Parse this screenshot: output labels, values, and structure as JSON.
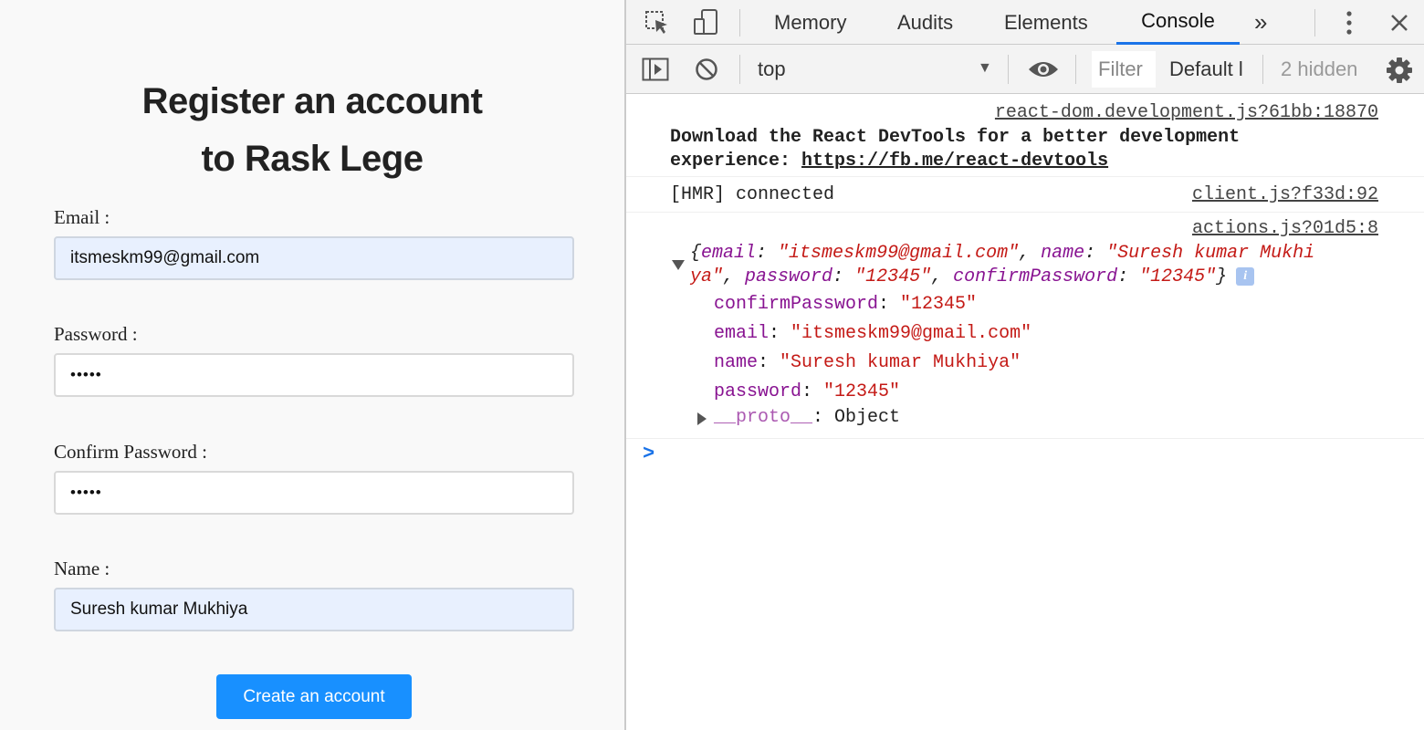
{
  "page": {
    "title_line1": "Register an account",
    "title_line2": "to Rask Lege",
    "fields": [
      {
        "label": "Email",
        "colon": ":",
        "value": "itsmeskm99@gmail.com"
      },
      {
        "label": "Password",
        "colon": ":",
        "value": "•••••"
      },
      {
        "label": "Confirm Password",
        "colon": ":",
        "value": "•••••"
      },
      {
        "label": "Name",
        "colon": ":",
        "value": "Suresh kumar Mukhiya"
      }
    ],
    "submit_label": "Create an account"
  },
  "devtools": {
    "tabs": [
      "Memory",
      "Audits",
      "Elements",
      "Console"
    ],
    "active_tab": "Console",
    "more_tabs": "»",
    "context": "top",
    "filter_placeholder": "Filter",
    "levels": "Default l",
    "hidden": "2 hidden",
    "icons": {
      "inspect": "inspect-element-icon",
      "device": "device-toolbar-icon",
      "menu": "kebab-menu-icon",
      "close": "close-icon",
      "sidebar": "console-sidebar-icon",
      "clear": "clear-console-icon",
      "eye": "live-expression-icon",
      "settings": "gear-icon"
    },
    "console": {
      "msg1": {
        "source": "react-dom.development.js?61bb:18870",
        "text1": "Download the React DevTools for a better development",
        "text2": "experience: ",
        "link": "https://fb.me/react-devtools"
      },
      "msg2": {
        "source": "client.js?f33d:92",
        "text": "[HMR] connected"
      },
      "msg3": {
        "source": "actions.js?01d5:8",
        "k_email": "email",
        "v_email": "\"itsmeskm99@gmail.com\"",
        "k_name": "name",
        "v_name_a": "\"Suresh kumar Mukhi",
        "v_name_b": "ya\"",
        "k_password": "password",
        "v_password": "\"12345\"",
        "k_confirm": "confirmPassword",
        "v_confirm": "\"12345\"",
        "expanded": [
          {
            "key": "confirmPassword",
            "value": "\"12345\""
          },
          {
            "key": "email",
            "value": "\"itsmeskm99@gmail.com\""
          },
          {
            "key": "name",
            "value": "\"Suresh kumar Mukhiya\""
          },
          {
            "key": "password",
            "value": "\"12345\""
          }
        ],
        "proto_key": "__proto__",
        "proto_value": "Object"
      },
      "prompt": ">"
    },
    "colors": {
      "accent": "#1a73e8",
      "key": "#881391",
      "string": "#c41a16",
      "button": "#1890ff"
    }
  }
}
